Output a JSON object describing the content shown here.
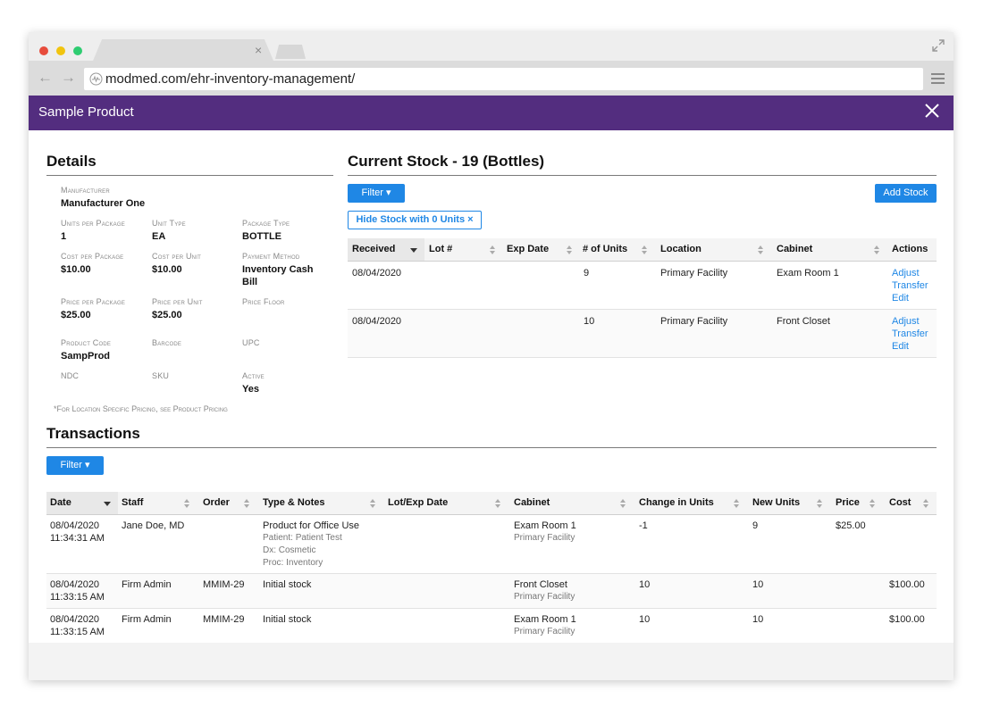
{
  "browser": {
    "url": "modmed.com/ehr-inventory-management/",
    "tab_close": "×",
    "back": "←",
    "forward": "→"
  },
  "app": {
    "title": "Sample Product"
  },
  "details": {
    "title": "Details",
    "manufacturer": {
      "label": "Manufacturer",
      "value": "Manufacturer One"
    },
    "units_per_package": {
      "label": "Units per Package",
      "value": "1"
    },
    "unit_type": {
      "label": "Unit Type",
      "value": "EA"
    },
    "package_type": {
      "label": "Package Type",
      "value": "BOTTLE"
    },
    "cost_per_package": {
      "label": "Cost per Package",
      "value": "$10.00"
    },
    "cost_per_unit": {
      "label": "Cost per Unit",
      "value": "$10.00"
    },
    "payment_method": {
      "label": "Payment Method",
      "value_line1": "Inventory Cash",
      "value_line2": "Bill"
    },
    "price_per_package": {
      "label": "Price per Package",
      "value": "$25.00"
    },
    "price_per_unit": {
      "label": "Price per Unit",
      "value": "$25.00"
    },
    "price_floor": {
      "label": "Price Floor"
    },
    "product_code": {
      "label": "Product Code",
      "value": "SampProd"
    },
    "barcode": {
      "label": "Barcode"
    },
    "upc": {
      "label": "UPC"
    },
    "ndc": {
      "label": "NDC"
    },
    "sku": {
      "label": "SKU"
    },
    "active": {
      "label": "Active",
      "value": "Yes"
    },
    "note": "*For Location Specific Pricing, see Product Pricing"
  },
  "stock": {
    "title": "Current Stock - 19 (Bottles)",
    "filter_label": "Filter ▾",
    "add_label": "Add Stock",
    "chip_label": "Hide Stock with 0 Units ×",
    "columns": [
      "Received",
      "Lot #",
      "Exp Date",
      "# of Units",
      "Location",
      "Cabinet",
      "Actions"
    ],
    "rows": [
      {
        "received": "08/04/2020",
        "lot": "",
        "exp": "",
        "units": "9",
        "location": "Primary Facility",
        "cabinet": "Exam Room 1",
        "actions": [
          "Adjust",
          "Transfer",
          "Edit"
        ]
      },
      {
        "received": "08/04/2020",
        "lot": "",
        "exp": "",
        "units": "10",
        "location": "Primary Facility",
        "cabinet": "Front Closet",
        "actions": [
          "Adjust",
          "Transfer",
          "Edit"
        ]
      }
    ]
  },
  "transactions": {
    "title": "Transactions",
    "filter_label": "Filter ▾",
    "columns": [
      "Date",
      "Staff",
      "Order",
      "Type & Notes",
      "Lot/Exp Date",
      "Cabinet",
      "Change in Units",
      "New Units",
      "Price",
      "Cost"
    ],
    "rows": [
      {
        "date": "08/04/2020",
        "time": "11:34:31 AM",
        "staff": "Jane Doe, MD",
        "order": "",
        "type": "Product for Office Use",
        "notes": [
          "Patient: Patient Test",
          "Dx: Cosmetic",
          "Proc: Inventory"
        ],
        "cabinet": "Exam Room 1",
        "facility": "Primary Facility",
        "change": "-1",
        "new_units": "9",
        "price": "$25.00",
        "cost": ""
      },
      {
        "date": "08/04/2020",
        "time": "11:33:15 AM",
        "staff": "Firm Admin",
        "order": "MMIM-29",
        "type": "Initial stock",
        "notes": [],
        "cabinet": "Front Closet",
        "facility": "Primary Facility",
        "change": "10",
        "new_units": "10",
        "price": "",
        "cost": "$100.00"
      },
      {
        "date": "08/04/2020",
        "time": "11:33:15 AM",
        "staff": "Firm Admin",
        "order": "MMIM-29",
        "type": "Initial stock",
        "notes": [],
        "cabinet": "Exam Room 1",
        "facility": "Primary Facility",
        "change": "10",
        "new_units": "10",
        "price": "",
        "cost": "$100.00"
      }
    ]
  },
  "colors": {
    "header_purple": "#532d7f",
    "button_blue": "#1f87e5",
    "link_blue": "#1f87e5"
  }
}
